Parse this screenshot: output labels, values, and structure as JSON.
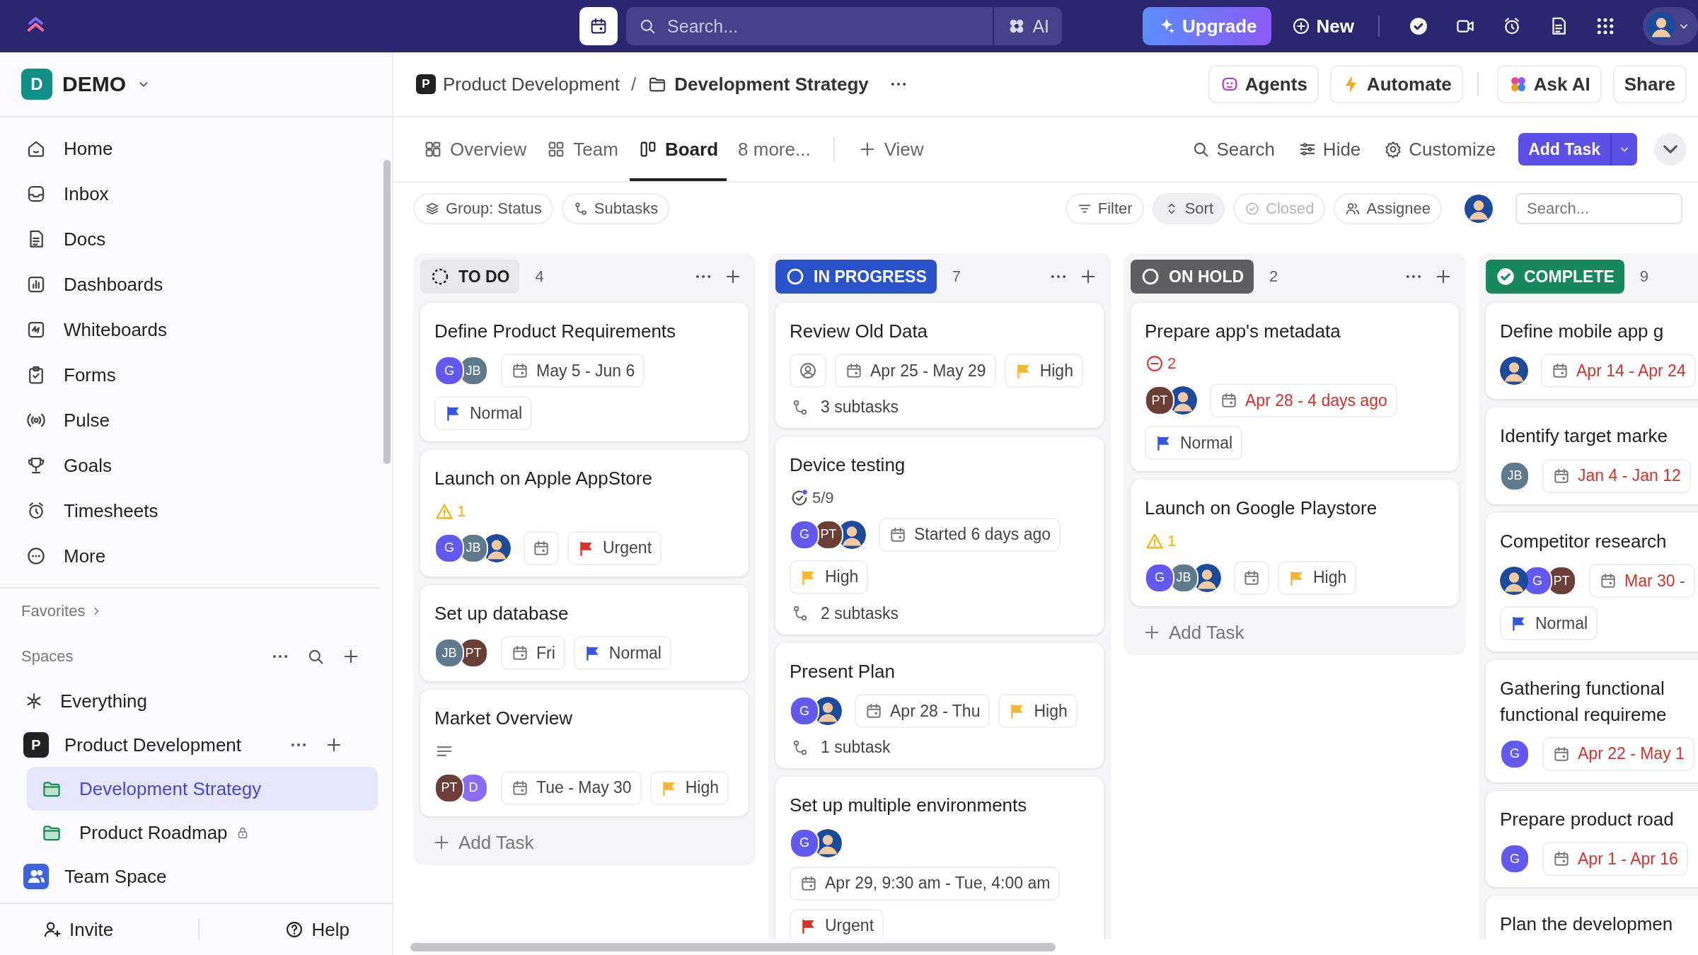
{
  "topbar": {
    "search_placeholder": "Search...",
    "ai_label": "AI",
    "upgrade": "Upgrade",
    "new": "New"
  },
  "workspace": {
    "initial": "D",
    "name": "DEMO"
  },
  "nav": [
    {
      "kind": "home",
      "label": "Home"
    },
    {
      "kind": "inbox",
      "label": "Inbox"
    },
    {
      "kind": "docs",
      "label": "Docs"
    },
    {
      "kind": "dashboards",
      "label": "Dashboards"
    },
    {
      "kind": "whiteboards",
      "label": "Whiteboards"
    },
    {
      "kind": "forms",
      "label": "Forms"
    },
    {
      "kind": "pulse",
      "label": "Pulse"
    },
    {
      "kind": "goals",
      "label": "Goals"
    },
    {
      "kind": "timesheets",
      "label": "Timesheets"
    },
    {
      "kind": "more",
      "label": "More"
    }
  ],
  "favorites": "Favorites",
  "spaces_label": "Spaces",
  "spaces": [
    {
      "kind": "everything",
      "label": "Everything",
      "selected": false
    },
    {
      "kind": "space",
      "initial": "P",
      "label": "Product Development",
      "selected": false,
      "children": [
        {
          "label": "Development Strategy",
          "selected": true,
          "locked": false
        },
        {
          "label": "Product Roadmap",
          "selected": false,
          "locked": true
        }
      ]
    },
    {
      "kind": "team",
      "label": "Team Space",
      "selected": false
    }
  ],
  "sidebar_footer": [
    {
      "kind": "invite",
      "label": "Invite"
    },
    {
      "kind": "help",
      "label": "Help"
    }
  ],
  "breadcrumb": [
    {
      "kind": "space",
      "initial": "P",
      "label": "Product Development"
    },
    {
      "kind": "folder",
      "separator": "/",
      "label": "Development Strategy"
    }
  ],
  "header_actions": [
    {
      "kind": "agents",
      "label": "Agents"
    },
    {
      "kind": "automate",
      "label": "Automate"
    },
    {
      "kind": "ask-ai",
      "label": "Ask AI"
    },
    {
      "kind": "share",
      "label": "Share"
    }
  ],
  "views": [
    {
      "kind": "overview",
      "label": "Overview",
      "selected": false
    },
    {
      "kind": "team",
      "label": "Team",
      "selected": false
    },
    {
      "kind": "board",
      "label": "Board",
      "selected": true
    },
    {
      "kind": "more",
      "label": "8 more...",
      "selected": false
    }
  ],
  "add_view": "View",
  "view_tools": [
    {
      "kind": "search",
      "label": "Search"
    },
    {
      "kind": "hide",
      "label": "Hide"
    },
    {
      "kind": "customize",
      "label": "Customize"
    }
  ],
  "add_task": "Add Task",
  "filters_left": [
    {
      "kind": "group",
      "label": "Group: Status"
    },
    {
      "kind": "subtasks",
      "label": "Subtasks"
    }
  ],
  "filters_right": [
    {
      "kind": "filter",
      "label": "Filter",
      "active": false,
      "disabled": false
    },
    {
      "kind": "sort",
      "label": "Sort",
      "active": true,
      "disabled": false
    },
    {
      "kind": "closed",
      "label": "Closed",
      "active": false,
      "disabled": true
    },
    {
      "kind": "assignee",
      "label": "Assignee",
      "active": false,
      "disabled": false
    }
  ],
  "board_search_placeholder": "Search...",
  "columns": [
    {
      "kind": "todo",
      "name": "TO DO",
      "count": "4",
      "color": "#e8e8eb",
      "menu": true,
      "add_task": "Add Task",
      "cards": [
        {
          "title": "Define Product Requirements",
          "assignees": [
            {
              "kind": "initials",
              "initials": "G",
              "color": "#6259f0"
            },
            {
              "kind": "initials",
              "initials": "JB",
              "color": "#5f7a8c"
            }
          ],
          "date": {
            "kind": "range",
            "text": "May 5 - Jun 6",
            "overdue": false
          },
          "priority": {
            "kind": "normal",
            "label": "Normal"
          }
        },
        {
          "title": "Launch on Apple AppStore",
          "badge": {
            "kind": "warning",
            "text": "1"
          },
          "assignees": [
            {
              "kind": "initials",
              "initials": "G",
              "color": "#6259f0"
            },
            {
              "kind": "initials",
              "initials": "JB",
              "color": "#5f7a8c"
            },
            {
              "kind": "picture"
            }
          ],
          "date": {
            "kind": "empty"
          },
          "priority": {
            "kind": "urgent",
            "label": "Urgent"
          }
        },
        {
          "title": "Set up database",
          "assignees": [
            {
              "kind": "initials",
              "initials": "JB",
              "color": "#5f7a8c"
            },
            {
              "kind": "initials",
              "initials": "PT",
              "color": "#6b3e36"
            }
          ],
          "date": {
            "kind": "range",
            "text": "Fri",
            "overdue": false
          },
          "priority": {
            "kind": "normal",
            "label": "Normal"
          }
        },
        {
          "title": "Market Overview",
          "badge": {
            "kind": "description"
          },
          "assignees": [
            {
              "kind": "initials",
              "initials": "PT",
              "color": "#6b3e36"
            },
            {
              "kind": "initials",
              "initials": "D",
              "color": "#8b6cf5"
            }
          ],
          "date": {
            "kind": "range",
            "text": "Tue - May 30",
            "overdue": false
          },
          "priority": {
            "kind": "high",
            "label": "High"
          }
        }
      ]
    },
    {
      "kind": "inprogress",
      "name": "IN PROGRESS",
      "count": "7",
      "color": "#2a53c9",
      "menu": true,
      "cards": [
        {
          "title": "Review Old Data",
          "unassigned": true,
          "date": {
            "kind": "range",
            "text": "Apr 25 - May 29",
            "overdue": false
          },
          "priority": {
            "kind": "high",
            "label": "High"
          },
          "subtasks": "3 subtasks"
        },
        {
          "title": "Device testing",
          "badge": {
            "kind": "checklist",
            "text": "5/9"
          },
          "assignees": [
            {
              "kind": "initials",
              "initials": "G",
              "color": "#6259f0"
            },
            {
              "kind": "initials",
              "initials": "PT",
              "color": "#6b3e36"
            },
            {
              "kind": "picture"
            }
          ],
          "date": {
            "kind": "range",
            "text": "Started 6 days ago",
            "overdue": false
          },
          "priority": {
            "kind": "high",
            "label": "High"
          },
          "subtasks": "2 subtasks"
        },
        {
          "title": "Present Plan",
          "assignees": [
            {
              "kind": "initials",
              "initials": "G",
              "color": "#6259f0"
            },
            {
              "kind": "picture"
            }
          ],
          "date": {
            "kind": "range",
            "text": "Apr 28 - Thu",
            "overdue": false
          },
          "priority": {
            "kind": "high",
            "label": "High"
          },
          "subtasks": "1 subtask"
        },
        {
          "title": "Set up multiple environments",
          "assignees": [
            {
              "kind": "initials",
              "initials": "G",
              "color": "#6259f0"
            },
            {
              "kind": "picture"
            }
          ],
          "date": {
            "kind": "range",
            "text": "Apr 29, 9:30 am - Tue, 4:00 am",
            "overdue": false
          },
          "priority": {
            "kind": "urgent",
            "label": "Urgent"
          }
        }
      ]
    },
    {
      "kind": "onhold",
      "name": "ON HOLD",
      "count": "2",
      "color": "#5f5f62",
      "menu": true,
      "add_task": "Add Task",
      "cards": [
        {
          "title": "Prepare app's metadata",
          "badge": {
            "kind": "blocked",
            "text": "2"
          },
          "assignees": [
            {
              "kind": "initials",
              "initials": "PT",
              "color": "#6b3e36"
            },
            {
              "kind": "picture"
            }
          ],
          "date": {
            "kind": "range",
            "text": "Apr 28 - 4 days ago",
            "overdue": true
          },
          "priority": {
            "kind": "normal",
            "label": "Normal"
          }
        },
        {
          "title": "Launch on Google Playstore",
          "badge": {
            "kind": "warning",
            "text": "1"
          },
          "assignees": [
            {
              "kind": "initials",
              "initials": "G",
              "color": "#6259f0"
            },
            {
              "kind": "initials",
              "initials": "JB",
              "color": "#5f7a8c"
            },
            {
              "kind": "picture"
            }
          ],
          "date": {
            "kind": "empty"
          },
          "priority": {
            "kind": "high",
            "label": "High"
          }
        }
      ]
    },
    {
      "kind": "complete",
      "name": "COMPLETE",
      "count": "9",
      "color": "#17875e",
      "menu": false,
      "cards": [
        {
          "title": "Define mobile app g",
          "assignees": [
            {
              "kind": "picture"
            }
          ],
          "date": {
            "kind": "range",
            "text": "Apr 14 - Apr 24",
            "overdue": true
          }
        },
        {
          "title": "Identify target marke",
          "assignees": [
            {
              "kind": "initials",
              "initials": "JB",
              "color": "#5f7a8c"
            }
          ],
          "date": {
            "kind": "range",
            "text": "Jan 4 - Jan 12",
            "overdue": true
          }
        },
        {
          "title": "Competitor research",
          "assignees": [
            {
              "kind": "picture"
            },
            {
              "kind": "initials",
              "initials": "G",
              "color": "#6259f0"
            },
            {
              "kind": "initials",
              "initials": "PT",
              "color": "#6b3e36"
            }
          ],
          "date": {
            "kind": "range",
            "text": "Mar 30 -",
            "overdue": true
          },
          "priority": {
            "kind": "normal",
            "label": "Normal"
          }
        },
        {
          "title": "Gathering functional\nfunctional requireme",
          "assignees": [
            {
              "kind": "initials",
              "initials": "G",
              "color": "#6259f0"
            }
          ],
          "date": {
            "kind": "range",
            "text": "Apr 22 - May 1",
            "overdue": true
          }
        },
        {
          "title": "Prepare product road",
          "assignees": [
            {
              "kind": "initials",
              "initials": "G",
              "color": "#6259f0"
            }
          ],
          "date": {
            "kind": "range",
            "text": "Apr 1 - Apr 16",
            "overdue": true
          }
        },
        {
          "title": "Plan the developmen"
        }
      ]
    }
  ]
}
